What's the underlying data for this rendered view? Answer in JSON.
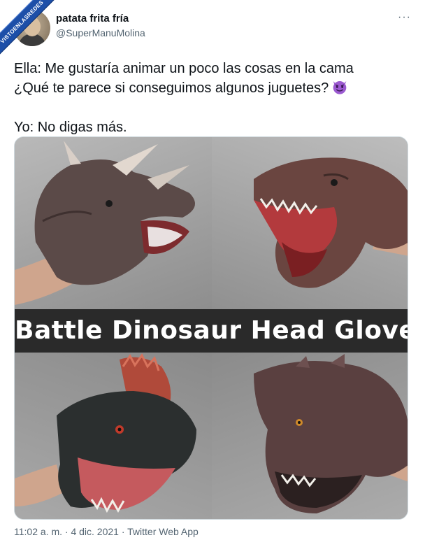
{
  "watermark": {
    "text": "VISTOENLASREDES"
  },
  "author": {
    "name": "patata frita fría",
    "handle": "@SuperManuMolina",
    "more_icon": "more-horizontal-icon"
  },
  "tweet": {
    "line1": "Ella: Me gustaría animar un poco las cosas en la cama",
    "line2": "¿Qué te parece si conseguimos algunos juguetes?",
    "emoji": "smiling-imp-emoji",
    "line3": "Yo: No digas más."
  },
  "media": {
    "banner_text": "Battle Dinosaur Head Gloves",
    "panels": [
      "triceratops-glove",
      "trex-glove",
      "dilophosaurus-glove",
      "carnotaurus-glove"
    ]
  },
  "footer": {
    "meta": "11:02 a. m. · 4 dic. 2021 · Twitter Web App"
  },
  "colors": {
    "text": "#0f1419",
    "secondary": "#536471",
    "emoji": "#9b59d0",
    "banner_bg": "#2a2a2a"
  }
}
